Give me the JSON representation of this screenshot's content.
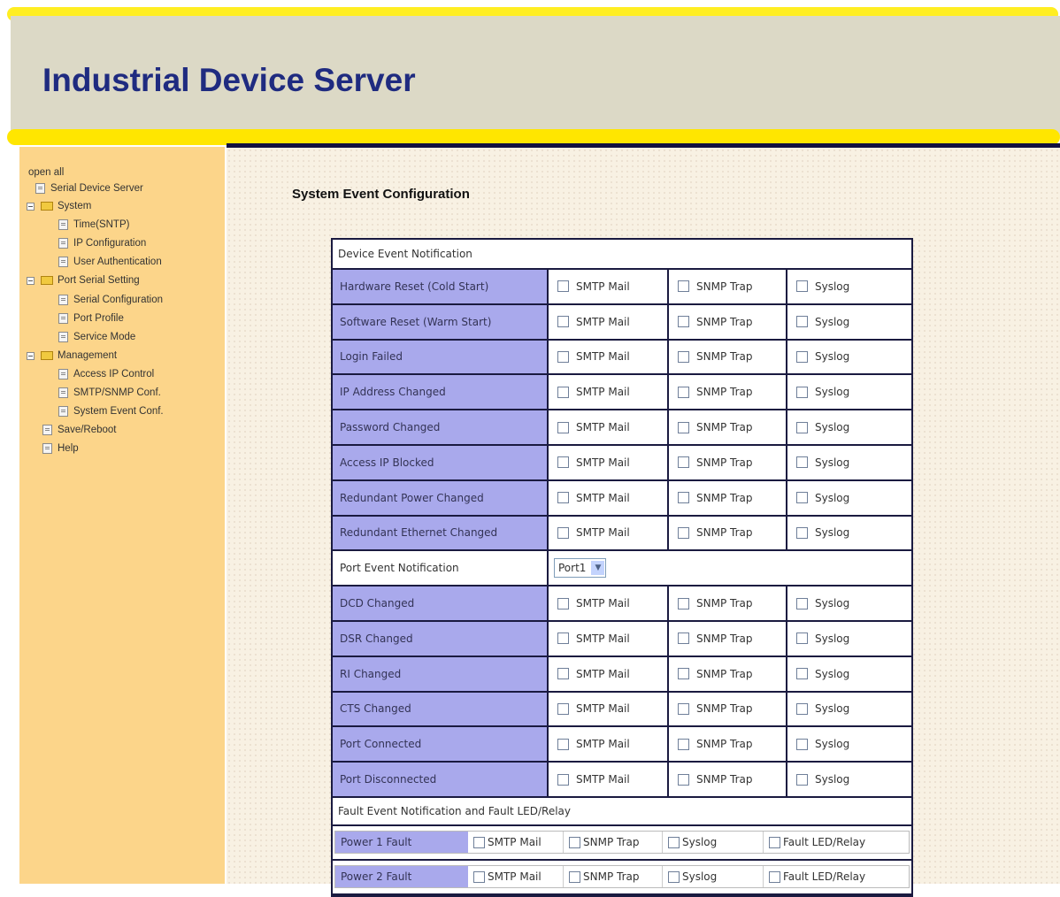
{
  "header": {
    "title": "Industrial Device Server"
  },
  "sidebar": {
    "open_all": "open all",
    "items": [
      {
        "label": "Serial Device Server"
      },
      {
        "label": "System"
      },
      {
        "label": "Time(SNTP)"
      },
      {
        "label": "IP Configuration"
      },
      {
        "label": "User Authentication"
      },
      {
        "label": "Port Serial Setting"
      },
      {
        "label": "Serial Configuration"
      },
      {
        "label": "Port Profile"
      },
      {
        "label": "Service Mode"
      },
      {
        "label": "Management"
      },
      {
        "label": "Access IP Control"
      },
      {
        "label": "SMTP/SNMP Conf."
      },
      {
        "label": "System Event Conf."
      },
      {
        "label": "Save/Reboot"
      },
      {
        "label": "Help"
      }
    ]
  },
  "main": {
    "title": "System Event Configuration",
    "options": {
      "smtp": "SMTP Mail",
      "snmp": "SNMP Trap",
      "syslog": "Syslog",
      "fault": "Fault LED/Relay"
    },
    "device_section": "Device Event Notification",
    "device_events": [
      "Hardware Reset (Cold Start)",
      "Software Reset (Warm Start)",
      "Login Failed",
      "IP Address Changed",
      "Password Changed",
      "Access IP Blocked",
      "Redundant Power Changed",
      "Redundant Ethernet Changed"
    ],
    "port_section": "Port Event Notification",
    "port_select_value": "Port1",
    "port_events": [
      "DCD Changed",
      "DSR Changed",
      "RI Changed",
      "CTS Changed",
      "Port Connected",
      "Port Disconnected"
    ],
    "fault_section": "Fault Event Notification and Fault LED/Relay",
    "fault_events": [
      "Power 1 Fault",
      "Power 2 Fault"
    ]
  },
  "colors": {
    "header_title": "#1f2b80",
    "header_bg": "#dcd9c6",
    "accent_yellow": "#ffe600",
    "sidebar_bg": "#fcd58a",
    "event_label_bg": "#a9a9ec"
  }
}
